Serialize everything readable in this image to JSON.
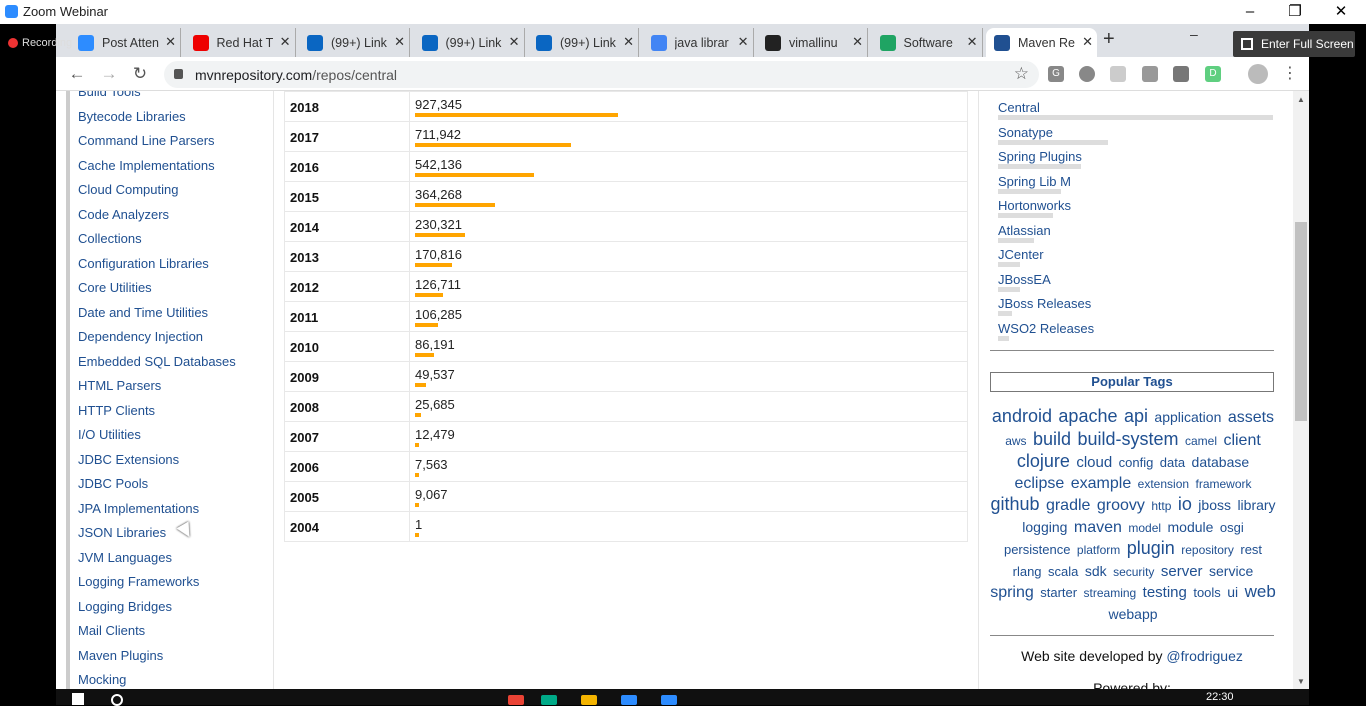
{
  "zoom": {
    "title": "Zoom Webinar",
    "recording": "Recording",
    "full_screen": "Enter Full Screen"
  },
  "browser": {
    "tabs": [
      {
        "title": "Post Atten",
        "icon": "zoom-icon",
        "color": "#2d8cff"
      },
      {
        "title": "Red Hat T",
        "icon": "redhat-icon",
        "color": "#e00"
      },
      {
        "title": "(99+) Link",
        "icon": "linkedin-icon",
        "color": "#0a66c2"
      },
      {
        "title": "(99+) Link",
        "icon": "linkedin-icon",
        "color": "#0a66c2"
      },
      {
        "title": "(99+) Link",
        "icon": "linkedin-icon",
        "color": "#0a66c2"
      },
      {
        "title": "java librar",
        "icon": "google-icon",
        "color": "#4285f4"
      },
      {
        "title": "vimallinu",
        "icon": "github-icon",
        "color": "#222"
      },
      {
        "title": "Software",
        "icon": "drive-icon",
        "color": "#1fa463"
      },
      {
        "title": "Maven Re",
        "icon": "mvn-icon",
        "color": "#205091"
      }
    ],
    "url_host": "mvnrepository.com",
    "url_path": "/repos/central"
  },
  "sidebar": {
    "items": [
      "Build Tools",
      "Bytecode Libraries",
      "Command Line Parsers",
      "Cache Implementations",
      "Cloud Computing",
      "Code Analyzers",
      "Collections",
      "Configuration Libraries",
      "Core Utilities",
      "Date and Time Utilities",
      "Dependency Injection",
      "Embedded SQL Databases",
      "HTML Parsers",
      "HTTP Clients",
      "I/O Utilities",
      "JDBC Extensions",
      "JDBC Pools",
      "JPA Implementations",
      "JSON Libraries",
      "JVM Languages",
      "Logging Frameworks",
      "Logging Bridges",
      "Mail Clients",
      "Maven Plugins",
      "Mocking"
    ]
  },
  "years": [
    {
      "year": "2018",
      "count": "927,345",
      "value": 927345
    },
    {
      "year": "2017",
      "count": "711,942",
      "value": 711942
    },
    {
      "year": "2016",
      "count": "542,136",
      "value": 542136
    },
    {
      "year": "2015",
      "count": "364,268",
      "value": 364268
    },
    {
      "year": "2014",
      "count": "230,321",
      "value": 230321
    },
    {
      "year": "2013",
      "count": "170,816",
      "value": 170816
    },
    {
      "year": "2012",
      "count": "126,711",
      "value": 126711
    },
    {
      "year": "2011",
      "count": "106,285",
      "value": 106285
    },
    {
      "year": "2010",
      "count": "86,191",
      "value": 86191
    },
    {
      "year": "2009",
      "count": "49,537",
      "value": 49537
    },
    {
      "year": "2008",
      "count": "25,685",
      "value": 25685
    },
    {
      "year": "2007",
      "count": "12,479",
      "value": 12479
    },
    {
      "year": "2006",
      "count": "7,563",
      "value": 7563
    },
    {
      "year": "2005",
      "count": "9,067",
      "value": 9067
    },
    {
      "year": "2004",
      "count": "1",
      "value": 1
    }
  ],
  "repositories": [
    {
      "name": "Central",
      "share": 1.0
    },
    {
      "name": "Sonatype",
      "share": 0.4
    },
    {
      "name": "Spring Plugins",
      "share": 0.3
    },
    {
      "name": "Spring Lib M",
      "share": 0.23
    },
    {
      "name": "Hortonworks",
      "share": 0.2
    },
    {
      "name": "Atlassian",
      "share": 0.13
    },
    {
      "name": "JCenter",
      "share": 0.08
    },
    {
      "name": "JBossEA",
      "share": 0.08
    },
    {
      "name": "JBoss Releases",
      "share": 0.05
    },
    {
      "name": "WSO2 Releases",
      "share": 0.04
    }
  ],
  "popular_tags": {
    "heading": "Popular Tags",
    "tags": [
      {
        "t": "android",
        "s": 18
      },
      {
        "t": "apache",
        "s": 18
      },
      {
        "t": "api",
        "s": 18
      },
      {
        "t": "application",
        "s": 14
      },
      {
        "t": "assets",
        "s": 16
      },
      {
        "t": "aws",
        "s": 12
      },
      {
        "t": "build",
        "s": 18
      },
      {
        "t": "build-system",
        "s": 18
      },
      {
        "t": "camel",
        "s": 12
      },
      {
        "t": "client",
        "s": 16
      },
      {
        "t": "clojure",
        "s": 18
      },
      {
        "t": "cloud",
        "s": 15
      },
      {
        "t": "config",
        "s": 13
      },
      {
        "t": "data",
        "s": 13
      },
      {
        "t": "database",
        "s": 14
      },
      {
        "t": "eclipse",
        "s": 16
      },
      {
        "t": "example",
        "s": 16
      },
      {
        "t": "extension",
        "s": 12
      },
      {
        "t": "framework",
        "s": 12
      },
      {
        "t": "github",
        "s": 18
      },
      {
        "t": "gradle",
        "s": 16
      },
      {
        "t": "groovy",
        "s": 16
      },
      {
        "t": "http",
        "s": 12
      },
      {
        "t": "io",
        "s": 18
      },
      {
        "t": "jboss",
        "s": 14
      },
      {
        "t": "library",
        "s": 14
      },
      {
        "t": "logging",
        "s": 14
      },
      {
        "t": "maven",
        "s": 16
      },
      {
        "t": "model",
        "s": 12
      },
      {
        "t": "module",
        "s": 14
      },
      {
        "t": "osgi",
        "s": 13
      },
      {
        "t": "persistence",
        "s": 13
      },
      {
        "t": "platform",
        "s": 12
      },
      {
        "t": "plugin",
        "s": 18
      },
      {
        "t": "repository",
        "s": 12
      },
      {
        "t": "rest",
        "s": 13
      },
      {
        "t": "rlang",
        "s": 13
      },
      {
        "t": "scala",
        "s": 13
      },
      {
        "t": "sdk",
        "s": 14
      },
      {
        "t": "security",
        "s": 12
      },
      {
        "t": "server",
        "s": 15
      },
      {
        "t": "service",
        "s": 14
      },
      {
        "t": "spring",
        "s": 16
      },
      {
        "t": "starter",
        "s": 13
      },
      {
        "t": "streaming",
        "s": 12
      },
      {
        "t": "testing",
        "s": 15
      },
      {
        "t": "tools",
        "s": 13
      },
      {
        "t": "ui",
        "s": 14
      },
      {
        "t": "web",
        "s": 17
      },
      {
        "t": "webapp",
        "s": 14
      }
    ]
  },
  "footer": {
    "credit": "Web site developed by",
    "author": "@frodriguez",
    "powered": "Powered by:"
  },
  "taskbar": {
    "time": "22:30"
  }
}
